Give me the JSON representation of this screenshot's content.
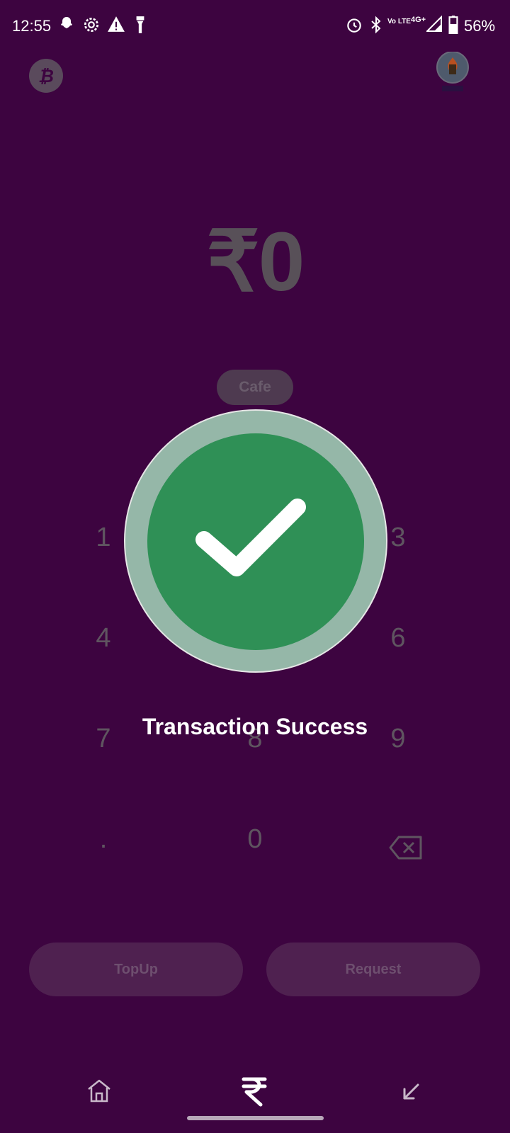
{
  "status_bar": {
    "time": "12:55",
    "battery": "56%",
    "network": "4G+",
    "volte": "Vo LTE",
    "icons": [
      "snapchat-icon",
      "settings-icon",
      "warning-icon",
      "flashlight-icon",
      "alarm-icon",
      "bluetooth-icon",
      "signal-icon",
      "battery-icon"
    ]
  },
  "header": {
    "left_icon": "bitcoin-icon",
    "right_icon": "profile-avatar"
  },
  "amount": {
    "currency": "₹",
    "value": "0"
  },
  "category": {
    "label": "Cafe"
  },
  "keypad": {
    "row1": [
      "1",
      "",
      "3"
    ],
    "row2": [
      "4",
      "",
      "6"
    ],
    "row3": [
      "7",
      "8",
      "9"
    ],
    "row4": [
      ".",
      "0"
    ],
    "backspace_icon": "backspace-icon"
  },
  "overlay": {
    "message": "Transaction Success",
    "icon": "check-icon",
    "colors": {
      "ring": "#95b7a8",
      "fill": "#2f9056"
    }
  },
  "actions": {
    "topup": "TopUp",
    "request": "Request"
  },
  "bottom_nav": {
    "items": [
      "home-icon",
      "rupee-icon",
      "arrow-down-left-icon"
    ]
  },
  "colors": {
    "background": "#3d0440",
    "accent": "#2f9056"
  }
}
